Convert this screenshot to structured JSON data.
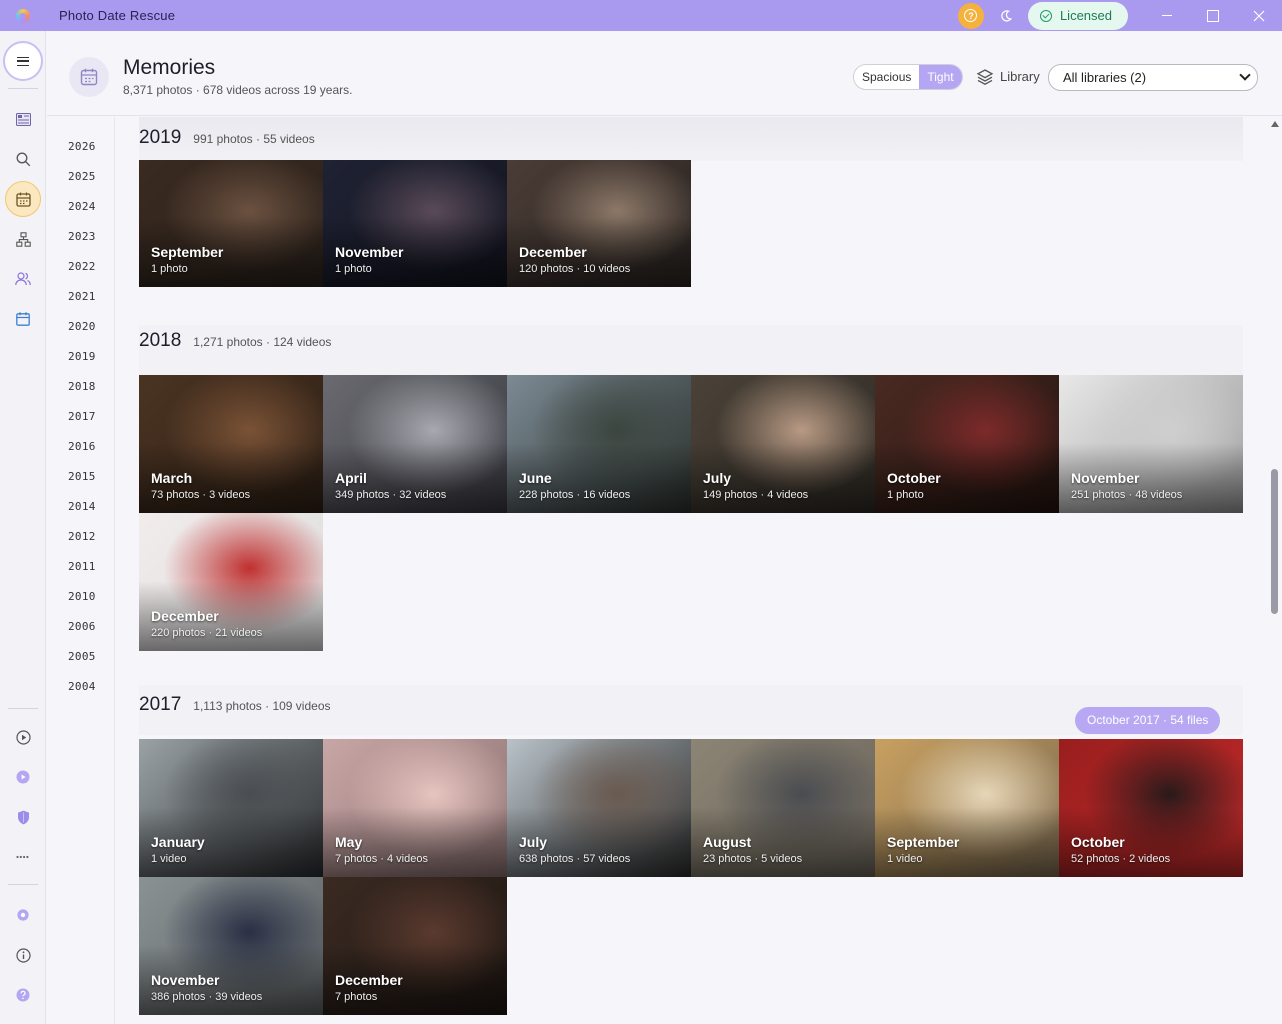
{
  "app": {
    "title": "Photo Date Rescue",
    "license_label": "Licensed"
  },
  "header": {
    "title": "Memories",
    "subtitle": "8,371 photos · 678 videos across 19 years.",
    "density_options": [
      "Spacious",
      "Tight"
    ],
    "density_selected": "Tight",
    "library_label": "Library",
    "library_select": "All libraries (2)"
  },
  "sidebar": {
    "icons": [
      "menu-icon",
      "dashboard-icon",
      "search-icon",
      "calendar-icon",
      "hierarchy-icon",
      "people-icon",
      "calendar-month-icon",
      "play-circle-icon",
      "video-icon",
      "shield-icon",
      "dots-icon",
      "settings-icon",
      "info-icon",
      "help-icon"
    ]
  },
  "year_rail": [
    "2026",
    "2025",
    "2024",
    "2023",
    "2022",
    "2021",
    "2020",
    "2019",
    "2018",
    "2017",
    "2016",
    "2015",
    "2014",
    "2012",
    "2011",
    "2010",
    "2006",
    "2005",
    "2004"
  ],
  "years": [
    {
      "year": "2019",
      "counts": "991 photos · 55 videos",
      "months": [
        {
          "month": "September",
          "counts": "1 photo",
          "colors": [
            "#3a2a20",
            "#6b5140",
            "#2b221c"
          ]
        },
        {
          "month": "November",
          "counts": "1 photo",
          "colors": [
            "#1f2233",
            "#5a4a58",
            "#12141f"
          ]
        },
        {
          "month": "December",
          "counts": "120 photos · 10 videos",
          "colors": [
            "#4a3c36",
            "#8c7868",
            "#2a2421"
          ]
        }
      ]
    },
    {
      "year": "2018",
      "counts": "1,271 photos · 124 videos",
      "months": [
        {
          "month": "March",
          "counts": "73 photos · 3 videos",
          "colors": [
            "#4a3322",
            "#7a5236",
            "#2e2015"
          ]
        },
        {
          "month": "April",
          "counts": "349 photos · 32 videos",
          "colors": [
            "#6a6a70",
            "#a8a8b0",
            "#383840"
          ]
        },
        {
          "month": "June",
          "counts": "228 photos · 16 videos",
          "colors": [
            "#7c8a94",
            "#3c4640",
            "#2a302c"
          ]
        },
        {
          "month": "July",
          "counts": "149 photos · 4 videos",
          "colors": [
            "#4a4238",
            "#b89a84",
            "#2e2a24"
          ]
        },
        {
          "month": "October",
          "counts": "1 photo",
          "colors": [
            "#4a2a22",
            "#7c2a2a",
            "#24140f"
          ]
        },
        {
          "month": "November",
          "counts": "251 photos · 48 videos",
          "colors": [
            "#e8e8e8",
            "#cfcfcf",
            "#9a9a9a"
          ]
        },
        {
          "month": "December",
          "counts": "220 photos · 21 videos",
          "colors": [
            "#f2ecec",
            "#c03030",
            "#dcdcdc"
          ]
        }
      ]
    },
    {
      "year": "2017",
      "counts": "1,113 photos · 109 videos",
      "months": [
        {
          "month": "January",
          "counts": "1 video",
          "colors": [
            "#9aa2a6",
            "#4a4e52",
            "#2a2c2e"
          ]
        },
        {
          "month": "May",
          "counts": "7 photos · 4 videos",
          "colors": [
            "#c9a6a6",
            "#e6c4bf",
            "#8a7070"
          ]
        },
        {
          "month": "July",
          "counts": "638 photos · 57 videos",
          "colors": [
            "#b8c2c8",
            "#6a5a50",
            "#2e2e2e"
          ]
        },
        {
          "month": "August",
          "counts": "23 photos · 5 videos",
          "colors": [
            "#8c8474",
            "#4a4c50",
            "#6a645a"
          ]
        },
        {
          "month": "September",
          "counts": "1 video",
          "colors": [
            "#c8a060",
            "#e6d6b8",
            "#7c6a50"
          ]
        },
        {
          "month": "October",
          "counts": "52 photos · 2 videos",
          "colors": [
            "#9a1e1e",
            "#2a1a1a",
            "#c02a2a"
          ]
        },
        {
          "month": "November",
          "counts": "386 photos · 39 videos",
          "colors": [
            "#8a9294",
            "#2a3044",
            "#5a5e60"
          ]
        },
        {
          "month": "December",
          "counts": "7 photos",
          "colors": [
            "#3a2a22",
            "#5a3a2e",
            "#1e1612"
          ]
        }
      ],
      "badge": "October 2017 · 54 files"
    }
  ],
  "colors": {
    "accent": "#a99af0",
    "badge": "#b8a8f4",
    "help": "#f4b23d"
  }
}
